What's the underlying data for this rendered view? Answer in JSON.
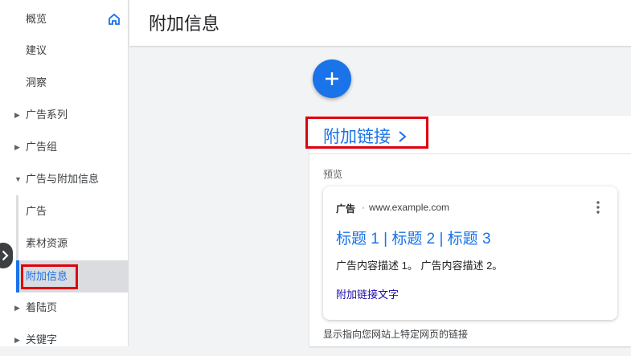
{
  "sidebar": {
    "items": [
      {
        "label": "概览"
      },
      {
        "label": "建议"
      },
      {
        "label": "洞察"
      },
      {
        "label": "广告系列"
      },
      {
        "label": "广告组"
      },
      {
        "label": "广告与附加信息"
      },
      {
        "label": "广告"
      },
      {
        "label": "素材资源"
      },
      {
        "label": "附加信息"
      },
      {
        "label": "着陆页"
      },
      {
        "label": "关键字"
      }
    ]
  },
  "header": {
    "title": "附加信息"
  },
  "panel": {
    "title": "附加链接",
    "preview_label": "预览",
    "ad": {
      "badge": "广告",
      "separator": "·",
      "url": "www.example.com",
      "headline": "标题 1 | 标题 2 | 标题 3",
      "description": "广告内容描述 1。 广告内容描述 2。",
      "sitelink": "附加链接文字"
    },
    "footer": "显示指向您网站上特定网页的链接"
  },
  "colors": {
    "accent": "#1a73e8",
    "highlight": "#e0000e",
    "link": "#1a0dab"
  }
}
